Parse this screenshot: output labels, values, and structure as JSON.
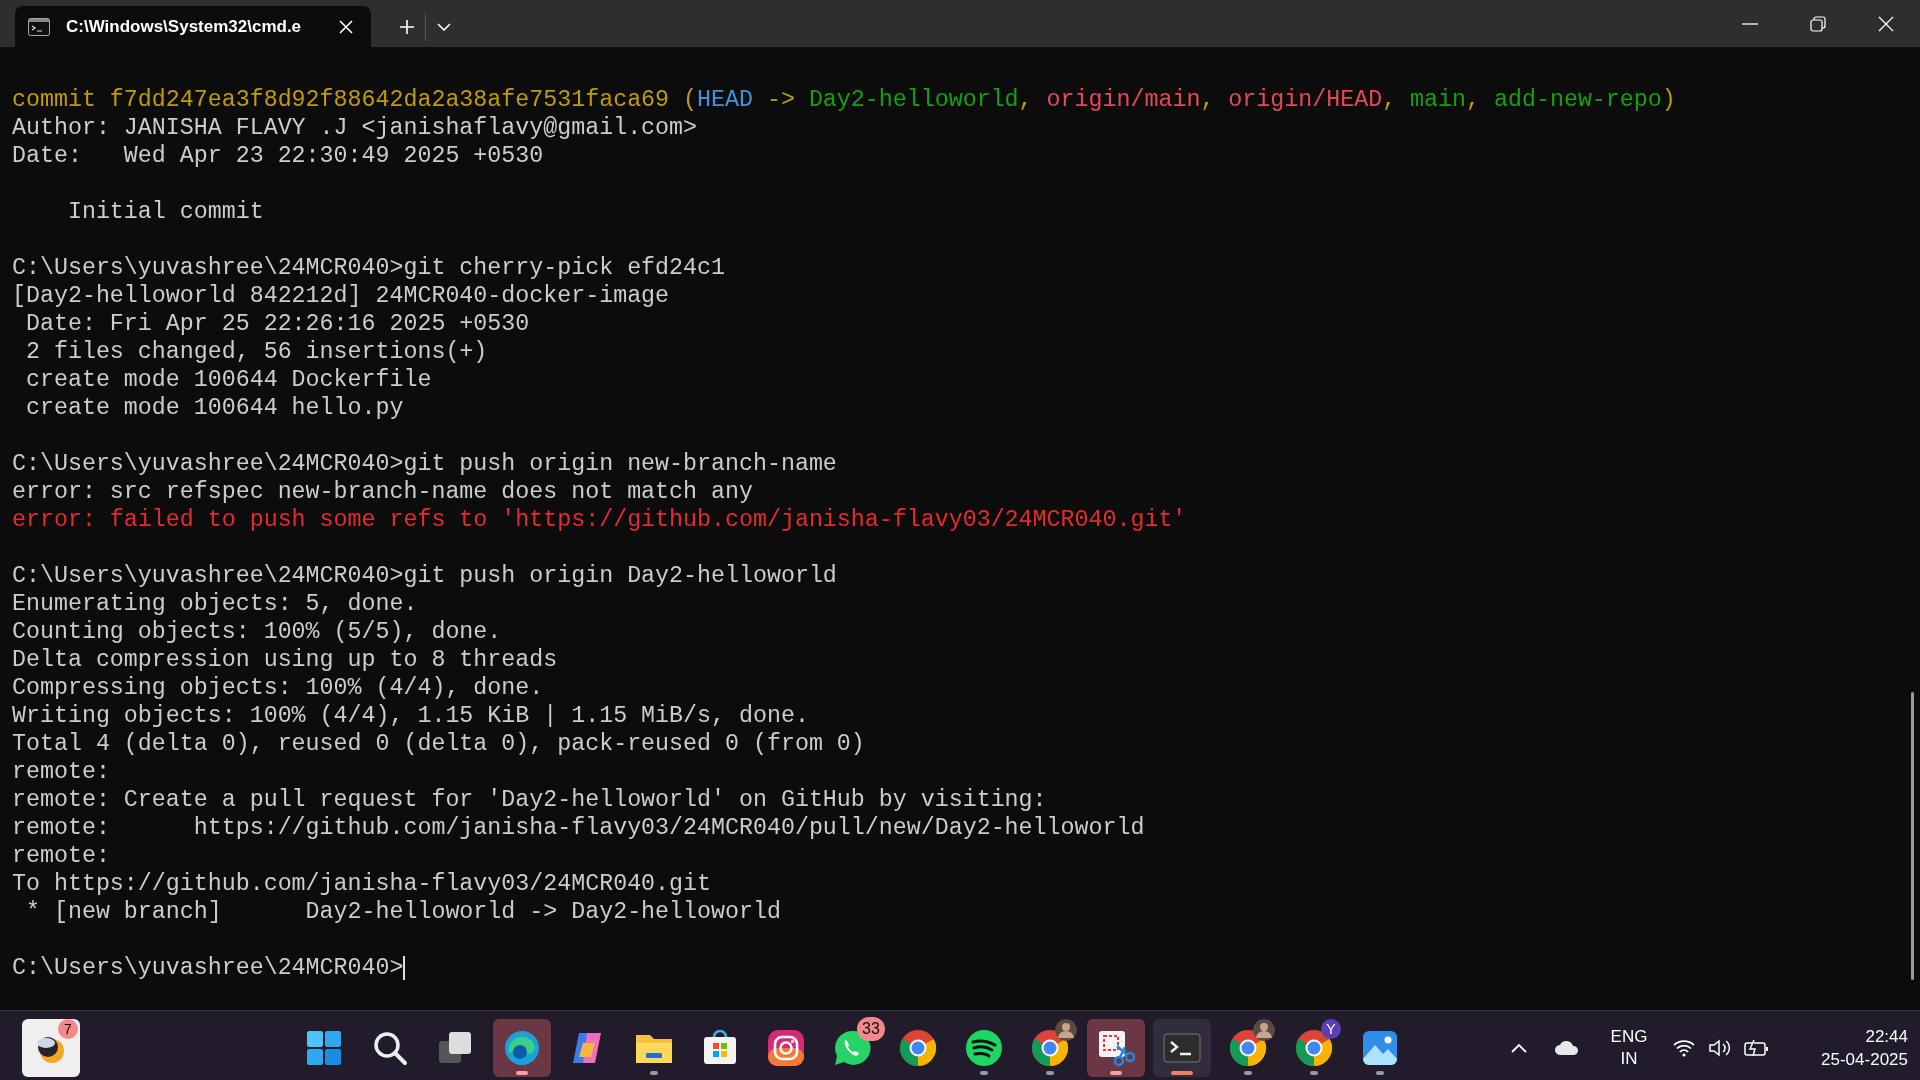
{
  "window": {
    "tab_title": "C:\\Windows\\System32\\cmd.e",
    "tab_selected": true
  },
  "terminal": {
    "cursor": true,
    "blocks": [
      {
        "lines": [
          {
            "segments": [
              {
                "text": "commit f7dd247ea3f8d92f88642da2a38afe7531faca69 (",
                "color": "#c19c00"
              },
              {
                "text": "HEAD",
                "color": "#3a96dd"
              },
              {
                "text": " -> ",
                "color": "#c19c00"
              },
              {
                "text": "Day2-helloworld",
                "color": "#13a10e"
              },
              {
                "text": ", ",
                "color": "#c19c00"
              },
              {
                "text": "origin/main",
                "color": "#e74856"
              },
              {
                "text": ", ",
                "color": "#c19c00"
              },
              {
                "text": "origin/HEAD",
                "color": "#e74856"
              },
              {
                "text": ", ",
                "color": "#c19c00"
              },
              {
                "text": "main",
                "color": "#13a10e"
              },
              {
                "text": ", ",
                "color": "#c19c00"
              },
              {
                "text": "add-new-repo",
                "color": "#13a10e"
              },
              {
                "text": ")",
                "color": "#c19c00"
              }
            ]
          },
          {
            "segments": [
              {
                "text": "Author: JANISHA FLAVY .J <janishaflavy@gmail.com>",
                "color": "#cccccc"
              }
            ]
          },
          {
            "segments": [
              {
                "text": "Date:   Wed Apr 23 22:30:49 2025 +0530",
                "color": "#cccccc"
              }
            ]
          }
        ]
      },
      {
        "lines": [
          {
            "segments": [
              {
                "text": "    Initial commit",
                "color": "#cccccc"
              }
            ]
          }
        ]
      },
      {
        "lines": [
          {
            "segments": [
              {
                "text": "C:\\Users\\yuvashree\\24MCR040>git cherry-pick efd24c1",
                "color": "#cccccc"
              }
            ]
          },
          {
            "segments": [
              {
                "text": "[Day2-helloworld 842212d] 24MCR040-docker-image",
                "color": "#cccccc"
              }
            ]
          },
          {
            "segments": [
              {
                "text": " Date: Fri Apr 25 22:26:16 2025 +0530",
                "color": "#cccccc"
              }
            ]
          },
          {
            "segments": [
              {
                "text": " 2 files changed, 56 insertions(+)",
                "color": "#cccccc"
              }
            ]
          },
          {
            "segments": [
              {
                "text": " create mode 100644 Dockerfile",
                "color": "#cccccc"
              }
            ]
          },
          {
            "segments": [
              {
                "text": " create mode 100644 hello.py",
                "color": "#cccccc"
              }
            ]
          }
        ]
      },
      {
        "lines": [
          {
            "segments": [
              {
                "text": "C:\\Users\\yuvashree\\24MCR040>git push origin new-branch-name",
                "color": "#cccccc"
              }
            ]
          },
          {
            "segments": [
              {
                "text": "error: src refspec new-branch-name does not match any",
                "color": "#cccccc"
              }
            ]
          },
          {
            "segments": [
              {
                "text": "error: failed to push some refs to 'https://github.com/janisha-flavy03/24MCR040.git'",
                "color": "#e52b2b"
              }
            ]
          }
        ]
      },
      {
        "lines": [
          {
            "segments": [
              {
                "text": "C:\\Users\\yuvashree\\24MCR040>git push origin Day2-helloworld",
                "color": "#cccccc"
              }
            ]
          },
          {
            "segments": [
              {
                "text": "Enumerating objects: 5, done.",
                "color": "#cccccc"
              }
            ]
          },
          {
            "segments": [
              {
                "text": "Counting objects: 100% (5/5), done.",
                "color": "#cccccc"
              }
            ]
          },
          {
            "segments": [
              {
                "text": "Delta compression using up to 8 threads",
                "color": "#cccccc"
              }
            ]
          },
          {
            "segments": [
              {
                "text": "Compressing objects: 100% (4/4), done.",
                "color": "#cccccc"
              }
            ]
          },
          {
            "segments": [
              {
                "text": "Writing objects: 100% (4/4), 1.15 KiB | 1.15 MiB/s, done.",
                "color": "#cccccc"
              }
            ]
          },
          {
            "segments": [
              {
                "text": "Total 4 (delta 0), reused 0 (delta 0), pack-reused 0 (from 0)",
                "color": "#cccccc"
              }
            ]
          },
          {
            "segments": [
              {
                "text": "remote:",
                "color": "#cccccc"
              }
            ]
          },
          {
            "segments": [
              {
                "text": "remote: Create a pull request for 'Day2-helloworld' on GitHub by visiting:",
                "color": "#cccccc"
              }
            ]
          },
          {
            "segments": [
              {
                "text": "remote:      https://github.com/janisha-flavy03/24MCR040/pull/new/Day2-helloworld",
                "color": "#cccccc"
              }
            ]
          },
          {
            "segments": [
              {
                "text": "remote:",
                "color": "#cccccc"
              }
            ]
          },
          {
            "segments": [
              {
                "text": "To https://github.com/janisha-flavy03/24MCR040.git",
                "color": "#cccccc"
              }
            ]
          },
          {
            "segments": [
              {
                "text": " * [new branch]      Day2-helloworld -> Day2-helloworld",
                "color": "#cccccc"
              }
            ]
          }
        ]
      },
      {
        "lines": [
          {
            "segments": [
              {
                "text": "C:\\Users\\yuvashree\\24MCR040>",
                "color": "#cccccc"
              }
            ]
          }
        ]
      }
    ]
  },
  "taskbar": {
    "weather": {
      "kind": "weather",
      "badge": {
        "text": "7",
        "color": "#f4878a"
      }
    },
    "apps": [
      {
        "kind": "start",
        "running": false,
        "attention": false,
        "selected": false
      },
      {
        "kind": "search",
        "running": false,
        "attention": false,
        "selected": false
      },
      {
        "kind": "task-view",
        "running": false,
        "attention": false,
        "selected": false
      },
      {
        "kind": "edge",
        "running": true,
        "attention": true,
        "selected": false
      },
      {
        "kind": "copilot",
        "running": false,
        "attention": false,
        "selected": false
      },
      {
        "kind": "file-explorer",
        "running": true,
        "attention": false,
        "selected": false
      },
      {
        "kind": "store",
        "running": false,
        "attention": false,
        "selected": false
      },
      {
        "kind": "instagram",
        "running": false,
        "attention": false,
        "selected": false
      },
      {
        "kind": "whatsapp",
        "running": false,
        "attention": false,
        "selected": false,
        "badge": {
          "text": "33",
          "color": "#f4878a"
        }
      },
      {
        "kind": "chrome",
        "running": false,
        "attention": false,
        "selected": false
      },
      {
        "kind": "spotify",
        "running": true,
        "attention": false,
        "selected": false
      },
      {
        "kind": "chrome",
        "running": true,
        "attention": false,
        "selected": false,
        "avatar": true
      },
      {
        "kind": "snipping-tool",
        "running": true,
        "attention": true,
        "selected": false
      },
      {
        "kind": "terminal",
        "running": true,
        "attention": false,
        "selected": true
      },
      {
        "kind": "chrome",
        "running": true,
        "attention": false,
        "selected": false,
        "avatar": true
      },
      {
        "kind": "chrome",
        "running": true,
        "attention": false,
        "selected": false,
        "badge": {
          "text": "Y",
          "color": "#5a3fb5"
        }
      },
      {
        "kind": "photos",
        "running": true,
        "attention": false,
        "selected": false
      }
    ],
    "tray": {
      "language": "ENG",
      "region": "IN",
      "time": "22:44",
      "date": "25-04-2025"
    }
  }
}
